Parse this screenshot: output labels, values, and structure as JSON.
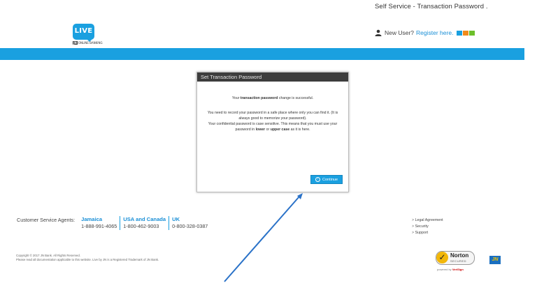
{
  "header": {
    "page_title": "Self Service - Transaction Password .",
    "logo_text": "LIVE",
    "logo_sub_mark": "JN",
    "logo_sub_text": "ONLINE BANKING",
    "new_user_text": "New User?",
    "register_link": "Register here.",
    "tile_colors": [
      "#1aa0e0",
      "#f08a1c",
      "#6cbf2a"
    ]
  },
  "colors": {
    "brand_blue": "#1aa0e0",
    "modal_header": "#3d3d3d"
  },
  "modal": {
    "title": "Set Transaction Password",
    "success_prefix": "Your",
    "success_bold": "transaction password",
    "success_suffix": "change is successful.",
    "line1": "You need to record your password in a safe place where only you can find it. (It is always good to memorize your password).",
    "line2_prefix": "Your confidential password is case sensitive. This means that you must use your password in",
    "lower": "lower",
    "or": "or",
    "upper": "upper case",
    "line2_suffix": "as it is here.",
    "continue_label": "Continue"
  },
  "footer": {
    "agents_label": "Customer Service Agents:",
    "regions": [
      {
        "name": "Jamaica",
        "number": "1-888-991-4065"
      },
      {
        "name": "USA and Canada",
        "number": "1-800-462-9003"
      },
      {
        "name": "UK",
        "number": "0-800-328-0387"
      }
    ],
    "links": [
      "Legal Agreement",
      "Security",
      "Support"
    ],
    "copyright_line1": "Copyright © 2017 JN Bank. All Rights Reserved.",
    "copyright_line2": "Please read all documentation applicable to this website. Live by JN is a Registered Trademark of JN Bank.",
    "norton_name": "Norton",
    "norton_secured": "SECURED",
    "norton_powered": "powered by",
    "norton_verisign": "VeriSign",
    "jn_logo_text": "JN"
  }
}
